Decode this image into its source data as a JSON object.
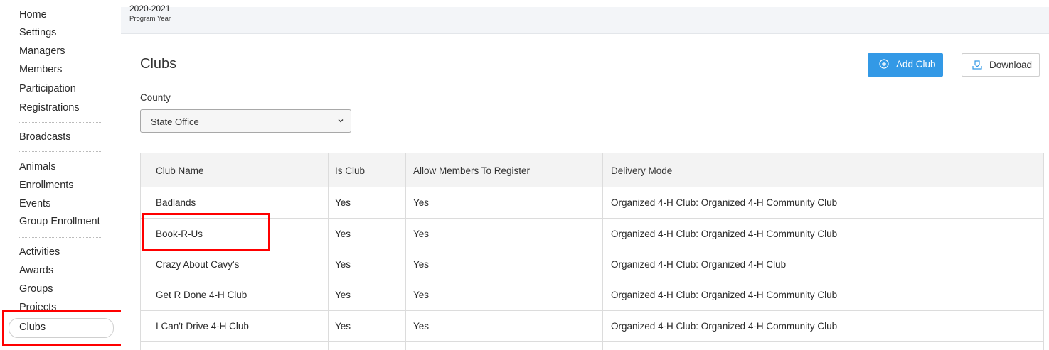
{
  "sidebar": {
    "items": [
      {
        "label": "Home"
      },
      {
        "label": "Settings"
      },
      {
        "label": "Managers"
      },
      {
        "label": "Members"
      },
      {
        "label": "Participation"
      },
      {
        "label": "Registrations"
      },
      {
        "label": "Broadcasts"
      },
      {
        "label": "Animals"
      },
      {
        "label": "Enrollments"
      },
      {
        "label": "Events"
      },
      {
        "label": "Group Enrollment"
      },
      {
        "label": "Activities"
      },
      {
        "label": "Awards"
      },
      {
        "label": "Groups"
      },
      {
        "label": "Projects"
      },
      {
        "label": "Clubs"
      }
    ],
    "active_item": "Clubs"
  },
  "header": {
    "program_year": "2020-2021",
    "program_year_label": "Program Year"
  },
  "page": {
    "title": "Clubs",
    "add_button": "Add Club",
    "download_button": "Download",
    "county_label": "County",
    "county_value": "State Office"
  },
  "table": {
    "columns": [
      "Club Name",
      "Is Club",
      "Allow Members To Register",
      "Delivery Mode"
    ],
    "rows": [
      {
        "name": "Badlands",
        "is_club": "Yes",
        "allow": "Yes",
        "mode": "Organized 4-H Club: Organized 4-H Community Club"
      },
      {
        "name": "Book-R-Us",
        "is_club": "Yes",
        "allow": "Yes",
        "mode": "Organized 4-H Club: Organized 4-H Community Club"
      },
      {
        "name": "Crazy About Cavy's",
        "is_club": "Yes",
        "allow": "Yes",
        "mode": "Organized 4-H Club: Organized 4-H Club"
      },
      {
        "name": "Get R Done 4-H Club",
        "is_club": "Yes",
        "allow": "Yes",
        "mode": "Organized 4-H Club: Organized 4-H Community Club"
      },
      {
        "name": "I Can't Drive 4-H Club",
        "is_club": "Yes",
        "allow": "Yes",
        "mode": "Organized 4-H Club: Organized 4-H Community Club"
      }
    ]
  },
  "colors": {
    "accent": "#3399e6",
    "highlight": "#ff0000"
  },
  "icons": {
    "add": "plus-circle-icon",
    "download": "download-tray-icon",
    "select": "chevron-down-icon"
  }
}
